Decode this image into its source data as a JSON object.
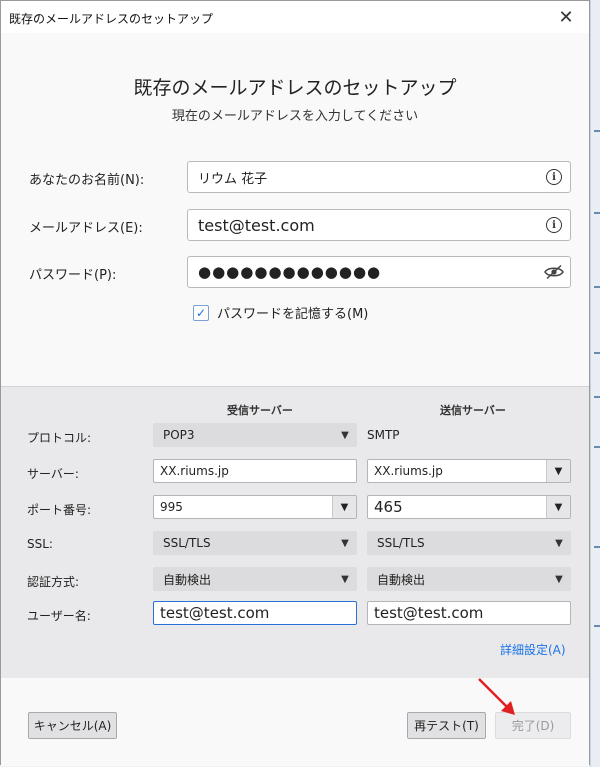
{
  "window": {
    "title": "既存のメールアドレスのセットアップ",
    "close_glyph": "✕"
  },
  "header": {
    "title": "既存のメールアドレスのセットアップ",
    "subtitle": "現在のメールアドレスを入力してください"
  },
  "form": {
    "name_label": "あなたのお名前(N):",
    "name_value": "リウム 花子",
    "email_label": "メールアドレス(E):",
    "email_value": "test@test.com",
    "password_label": "パスワード(P):",
    "password_value": "●●●●●●●●●●●●●",
    "remember_label": "パスワードを記憶する(M)",
    "remember_checked": true
  },
  "servers": {
    "incoming_header": "受信サーバー",
    "outgoing_header": "送信サーバー",
    "rows": {
      "protocol": {
        "label": "プロトコル:",
        "incoming": "POP3",
        "outgoing": "SMTP"
      },
      "server": {
        "label": "サーバー:",
        "incoming": "XX.riums.jp",
        "outgoing": "XX.riums.jp"
      },
      "port": {
        "label": "ポート番号:",
        "incoming": "995",
        "outgoing": "465"
      },
      "ssl": {
        "label": "SSL:",
        "incoming": "SSL/TLS",
        "outgoing": "SSL/TLS"
      },
      "auth": {
        "label": "認証方式:",
        "incoming": "自動検出",
        "outgoing": "自動検出"
      },
      "username": {
        "label": "ユーザー名:",
        "incoming": "test@test.com",
        "outgoing": "test@test.com"
      }
    },
    "advanced_link": "詳細設定(A)"
  },
  "footer": {
    "cancel": "キャンセル(A)",
    "retest": "再テスト(T)",
    "done": "完了(D)"
  },
  "colors": {
    "accent": "#1a73e8",
    "annotation_arrow": "#e02020"
  }
}
